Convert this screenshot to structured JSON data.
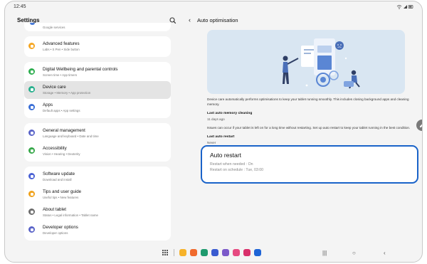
{
  "status": {
    "time": "12:45",
    "icons": "wifi-icon signal-icon battery-icon"
  },
  "settings": {
    "title": "Settings"
  },
  "left_list": {
    "top_partial_sub": "Google services",
    "groups": [
      [
        {
          "icon": "advanced-features-icon",
          "color": "#f5a623",
          "title": "Advanced features",
          "sub": "Labs  •  S Pen  •  Side button"
        }
      ],
      [
        {
          "icon": "digital-wellbeing-icon",
          "color": "#2fae50",
          "title": "Digital Wellbeing and parental controls",
          "sub": "Screen time  •  App timers"
        },
        {
          "icon": "device-care-icon",
          "color": "#29b08e",
          "title": "Device care",
          "sub": "Storage  •  Memory  •  App protection",
          "selected": true
        },
        {
          "icon": "apps-icon",
          "color": "#3b6fd6",
          "title": "Apps",
          "sub": "Default apps  •  App settings"
        }
      ],
      [
        {
          "icon": "general-management-icon",
          "color": "#5a64c8",
          "title": "General management",
          "sub": "Language and keyboard  •  Date and time"
        },
        {
          "icon": "accessibility-icon",
          "color": "#37a84a",
          "title": "Accessibility",
          "sub": "Vision  •  Hearing  •  Dexterity"
        }
      ],
      [
        {
          "icon": "software-update-icon",
          "color": "#4b62d4",
          "title": "Software update",
          "sub": "Download and install"
        },
        {
          "icon": "tips-icon",
          "color": "#f0a21c",
          "title": "Tips and user guide",
          "sub": "Useful tips  •  New features"
        },
        {
          "icon": "about-tablet-icon",
          "color": "#6d6d6d",
          "title": "About tablet",
          "sub": "Status  •  Legal information  •  Tablet name"
        },
        {
          "icon": "developer-options-icon",
          "color": "#5a64c8",
          "title": "Developer options",
          "sub": "Developer options"
        }
      ]
    ]
  },
  "detail": {
    "title": "Auto optimisation",
    "description": "Device care automatically performs optimisations to keep your tablet running smoothly. This includes closing background apps and cleaning memory.",
    "last_mem_label": "Last auto memory cleaning",
    "last_mem_value": "11 days ago",
    "issues_text": "Issues can occur if your tablet is left on for a long time without restarting. Set up auto restart to keep your tablet running in the best condition.",
    "last_restart_label": "Last auto restart",
    "last_restart_value": "Never"
  },
  "auto_restart": {
    "title": "Auto restart",
    "line1": "Restart when needed : On",
    "line2": "Restart on schedule : Tue, 03:00"
  },
  "dock": {
    "apps": [
      {
        "name": "my-files-app-icon",
        "color": "#f6b22a"
      },
      {
        "name": "samsung-notes-app-icon",
        "color": "#f06a2d"
      },
      {
        "name": "messages-app-icon",
        "color": "#1f9a6e"
      },
      {
        "name": "internet-app-icon",
        "color": "#3a5bd0"
      },
      {
        "name": "bixby-app-icon",
        "color": "#7b59c9"
      },
      {
        "name": "galaxy-store-app-icon",
        "color": "#e64a80"
      },
      {
        "name": "flower-app-icon",
        "color": "#d9306b"
      },
      {
        "name": "settings-app-icon",
        "color": "#1f64d6"
      }
    ]
  }
}
